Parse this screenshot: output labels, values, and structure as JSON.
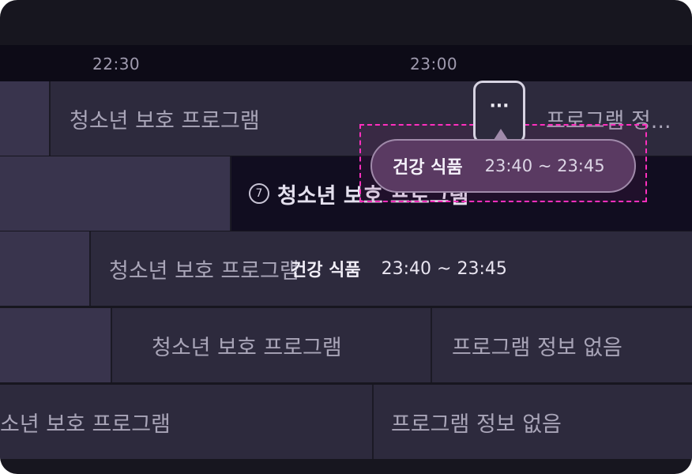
{
  "timeline": {
    "times": [
      "22:30",
      "23:00"
    ]
  },
  "rows": [
    {
      "cells": [
        {
          "label": ""
        },
        {
          "label": "청소년 보호 프로그램"
        },
        {
          "label": "프로그램 정..."
        }
      ]
    },
    {
      "cells": [
        {
          "label": ""
        },
        {
          "badge": "7",
          "label": "청소년 보호 프로그램"
        }
      ]
    },
    {
      "cells": [
        {
          "label": ""
        },
        {
          "label": "청소년 보호 프로그램"
        }
      ],
      "overlay": {
        "name": "건강 식품",
        "time": "23:40 ~ 23:45"
      }
    },
    {
      "cells": [
        {
          "label": ""
        },
        {
          "label": "청소년 보호 프로그램"
        },
        {
          "label": "프로그램 정보 없음"
        }
      ]
    },
    {
      "cells": [
        {
          "label": "소년 보호 프로그램"
        },
        {
          "label": "프로그램 정보 없음"
        }
      ]
    }
  ],
  "more_button": {
    "label": "···"
  },
  "tooltip": {
    "name": "건강 식품",
    "time": "23:40 ~ 23:45"
  },
  "colors": {
    "background": "#17161f",
    "focus_highlight": "#ff2fbe",
    "tooltip_bg": "#5a3a62"
  }
}
